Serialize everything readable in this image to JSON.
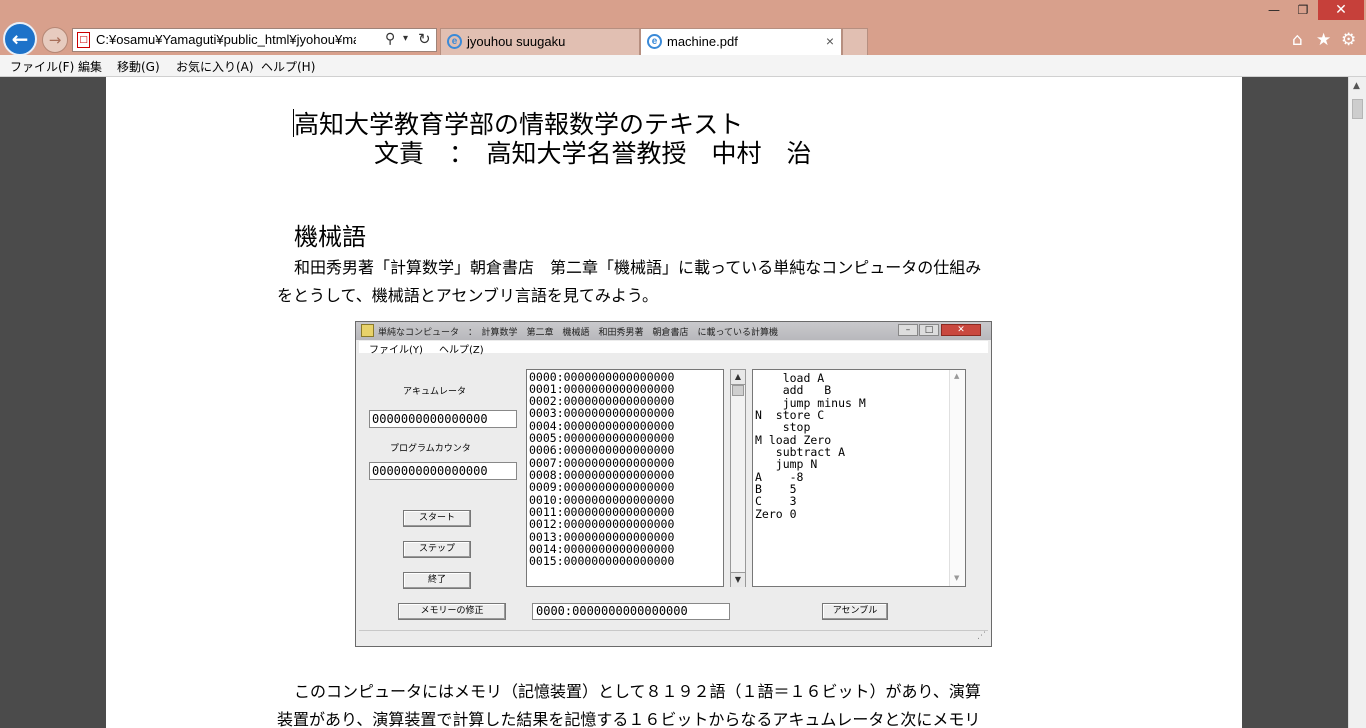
{
  "browser": {
    "address": "C:¥osamu¥Yamaguti¥public_html¥jyohou¥machine.pdf",
    "tabs": [
      {
        "label": "jyouhou suugaku"
      },
      {
        "label": "machine.pdf",
        "close": "×"
      }
    ],
    "menu": [
      "ファイル(F)",
      "編集",
      "移動(G)",
      "お気に入り(A)",
      "ヘルプ(H)"
    ]
  },
  "document": {
    "title": "高知大学教育学部の情報数学のテキスト",
    "author": "文責　：　高知大学名誉教授　中村　治",
    "section": "機械語",
    "paragraph1": [
      "和田秀男著「計算数学」朝倉書店　第二章「機械語」に載っている単純なコンピュータの仕組み",
      "をとうして、機械語とアセンブリ言語を見てみよう。"
    ],
    "paragraph2": [
      "このコンピュータにはメモリ（記憶装置）として８１９２語（１語＝１６ビット）があり、演算",
      "装置があり、演算装置で計算した結果を記憶する１６ビットからなるアキュムレータと次にメモリ"
    ]
  },
  "app": {
    "title": "単純なコンピュータ　：　計算数学　第二章　機械語　和田秀男著　朝倉書店　に載っている計算機",
    "menu": [
      "ファイル(Y)",
      "ヘルプ(Z)"
    ],
    "accumulator_label": "アキュムレータ",
    "accumulator_value": "0000000000000000",
    "pc_label": "プログラムカウンタ",
    "pc_value": "0000000000000000",
    "buttons": {
      "start": "スタート",
      "step": "ステップ",
      "end": "終了",
      "modify": "メモリーの修正",
      "assemble": "アセンブル"
    },
    "memory": [
      "0000:0000000000000000",
      "0001:0000000000000000",
      "0002:0000000000000000",
      "0003:0000000000000000",
      "0004:0000000000000000",
      "0005:0000000000000000",
      "0006:0000000000000000",
      "0007:0000000000000000",
      "0008:0000000000000000",
      "0009:0000000000000000",
      "0010:0000000000000000",
      "0011:0000000000000000",
      "0012:0000000000000000",
      "0013:0000000000000000",
      "0014:0000000000000000",
      "0015:0000000000000000"
    ],
    "code": [
      "    load A",
      "    add   B",
      "    jump minus M",
      "N  store C",
      "    stop",
      "M load Zero",
      "   subtract A",
      "   jump N",
      "A    -8",
      "B    5",
      "C    3",
      "Zero 0"
    ],
    "address_value": "0000:0000000000000000"
  }
}
